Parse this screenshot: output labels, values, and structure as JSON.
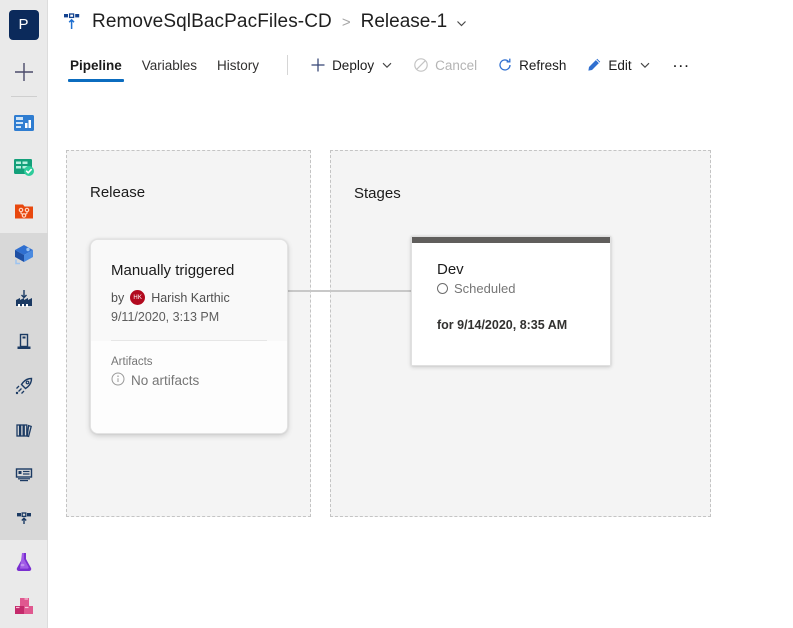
{
  "sidebar": {
    "project_initial": "P",
    "add_label": "add-new",
    "items": [
      {
        "name": "overview",
        "label": "Overview"
      },
      {
        "name": "boards",
        "label": "Boards"
      },
      {
        "name": "repos",
        "label": "Repos"
      },
      {
        "name": "pipelines",
        "label": "Pipelines"
      },
      {
        "name": "pipelines-builds",
        "label": "Pipelines"
      },
      {
        "name": "environments",
        "label": "Environments"
      },
      {
        "name": "releases",
        "label": "Releases"
      },
      {
        "name": "library",
        "label": "Library"
      },
      {
        "name": "task-groups",
        "label": "Task groups"
      },
      {
        "name": "deployment-groups",
        "label": "Deployment groups"
      },
      {
        "name": "test-plans",
        "label": "Test Plans"
      },
      {
        "name": "artifacts",
        "label": "Artifacts"
      }
    ]
  },
  "breadcrumb": {
    "pipeline_name": "RemoveSqlBacPacFiles-CD",
    "separator": ">",
    "release_name": "Release-1",
    "chevron": "chevron-down"
  },
  "toolbar": {
    "tabs": [
      {
        "label": "Pipeline",
        "active": true
      },
      {
        "label": "Variables",
        "active": false
      },
      {
        "label": "History",
        "active": false
      }
    ],
    "deploy_label": "Deploy",
    "cancel_label": "Cancel",
    "refresh_label": "Refresh",
    "edit_label": "Edit",
    "more_label": "..."
  },
  "canvas": {
    "release_zone_title": "Release",
    "stages_zone_title": "Stages",
    "release_card": {
      "title": "Manually triggered",
      "by_label": "by",
      "avatar_initials": "HK",
      "author": "Harish Karthic",
      "date": "9/11/2020, 3:13 PM",
      "artifacts_label": "Artifacts",
      "artifacts_value": "No artifacts"
    },
    "stage_card": {
      "name": "Dev",
      "status": "Scheduled",
      "scheduled_for": "for 9/14/2020, 8:35 AM"
    }
  },
  "colors": {
    "accent": "#0b6cbf",
    "project_logo_bg": "#0b2a5b",
    "avatar_bg": "#b20a1f",
    "stage_bar": "#605e5c",
    "zone_bg": "#f4f4f4",
    "zone_border": "#c4c4c4"
  }
}
